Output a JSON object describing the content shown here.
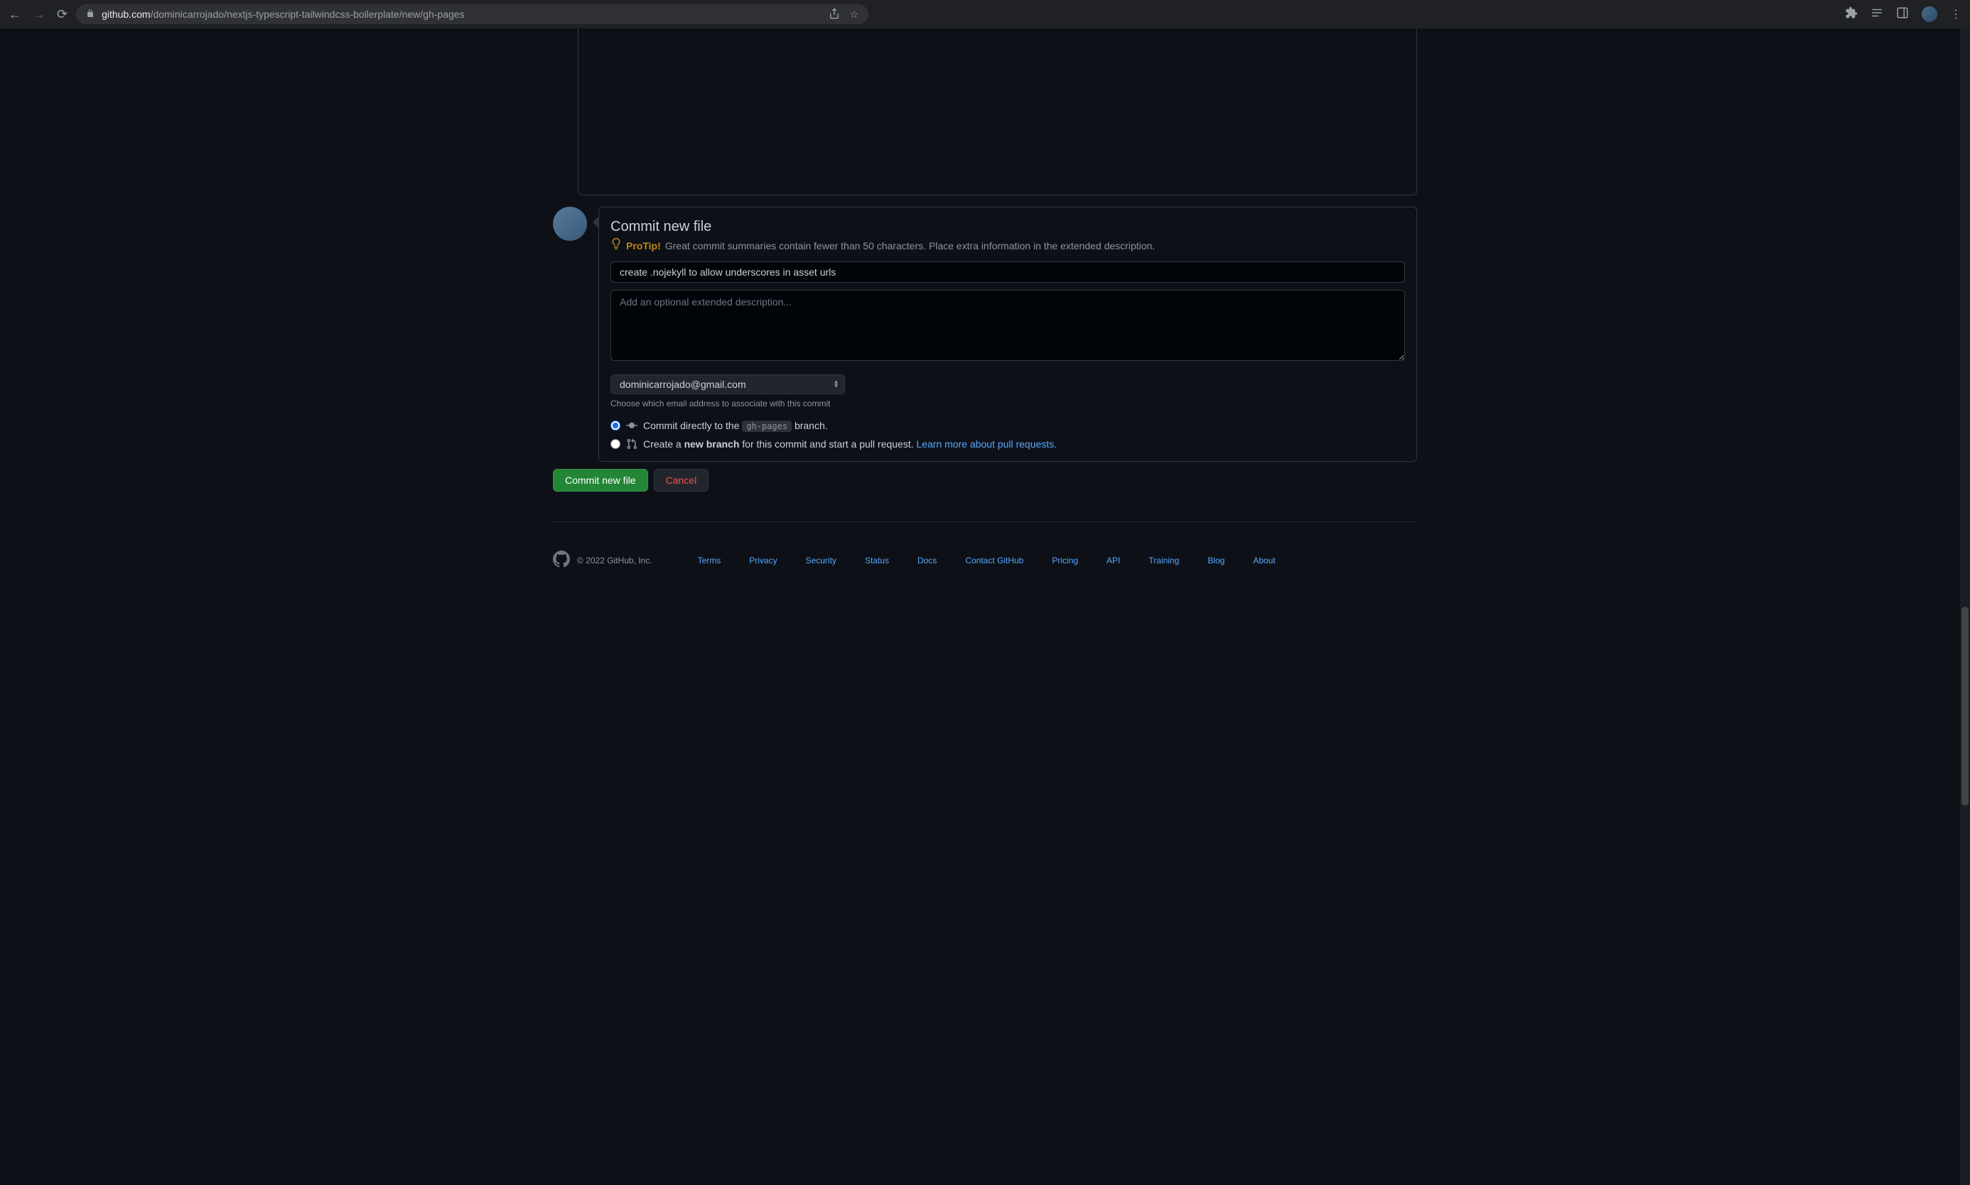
{
  "browser": {
    "url_domain": "github.com",
    "url_path": "/dominicarrojado/nextjs-typescript-tailwindcss-boilerplate/new/gh-pages"
  },
  "commit": {
    "heading": "Commit new file",
    "protip_label": "ProTip!",
    "protip_text": "Great commit summaries contain fewer than 50 characters. Place extra information in the extended description.",
    "summary_value": "create .nojekyll to allow underscores in asset urls",
    "description_placeholder": "Add an optional extended description...",
    "email_value": "dominicarrojado@gmail.com",
    "email_hint": "Choose which email address to associate with this commit",
    "radio1_prefix": "Commit directly to the ",
    "radio1_branch": "gh-pages",
    "radio1_suffix": " branch.",
    "radio2_prefix": "Create a ",
    "radio2_bold": "new branch",
    "radio2_middle": " for this commit and start a pull request. ",
    "radio2_link": "Learn more about pull requests.",
    "submit_label": "Commit new file",
    "cancel_label": "Cancel"
  },
  "footer": {
    "copyright": "© 2022 GitHub, Inc.",
    "links": [
      "Terms",
      "Privacy",
      "Security",
      "Status",
      "Docs",
      "Contact GitHub",
      "Pricing",
      "API",
      "Training",
      "Blog",
      "About"
    ]
  }
}
